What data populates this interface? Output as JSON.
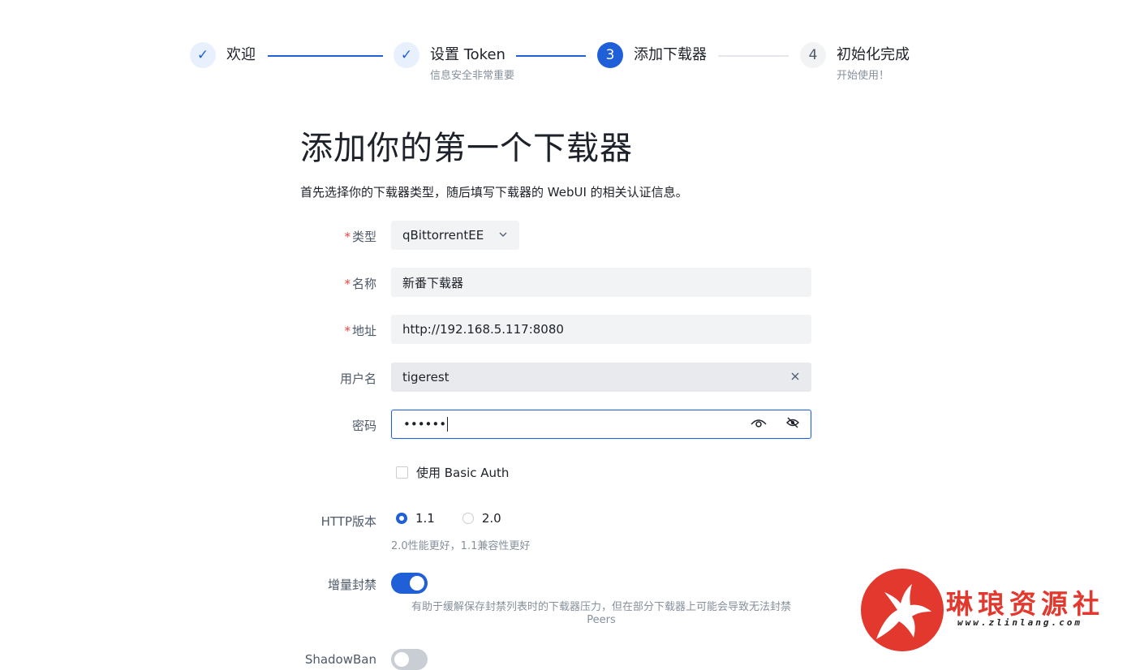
{
  "steps": [
    {
      "title": "欢迎",
      "desc": "",
      "state": "done",
      "marker": "✓"
    },
    {
      "title": "设置 Token",
      "desc": "信息安全非常重要",
      "state": "done",
      "marker": "✓"
    },
    {
      "title": "添加下载器",
      "desc": "",
      "state": "active",
      "marker": "3"
    },
    {
      "title": "初始化完成",
      "desc": "开始使用！",
      "state": "todo",
      "marker": "4"
    }
  ],
  "heading": {
    "title": "添加你的第一个下载器",
    "description": "首先选择你的下载器类型，随后填写下载器的 WebUI 的相关认证信息。"
  },
  "form": {
    "required_mark": "*",
    "type": {
      "label": "类型",
      "value": "qBittorrentEE"
    },
    "name": {
      "label": "名称",
      "value": "新番下载器"
    },
    "address": {
      "label": "地址",
      "value": "http://192.168.5.117:8080"
    },
    "username": {
      "label": "用户名",
      "value": "tigerest"
    },
    "password": {
      "label": "密码",
      "value": "••••••"
    },
    "basic_auth": {
      "label": "使用 Basic Auth",
      "checked": false
    },
    "http_version": {
      "label": "HTTP版本",
      "options": [
        "1.1",
        "2.0"
      ],
      "selected": "1.1",
      "help": "2.0性能更好，1.1兼容性更好"
    },
    "incremental_ban": {
      "label": "增量封禁",
      "enabled": true,
      "help_line1": "有助于缓解保存封禁列表时的下载器压力，但在部分下载器上可能会导致无法封禁",
      "help_line2": "Peers"
    },
    "shadowban": {
      "label": "ShadowBan",
      "enabled": false
    }
  },
  "watermark": {
    "text": "琳琅资源社",
    "url": "www.zlinlang.com"
  },
  "colors": {
    "primary": "#1f5fd8",
    "required": "#f53f3f",
    "watermark": "#e2382d"
  }
}
